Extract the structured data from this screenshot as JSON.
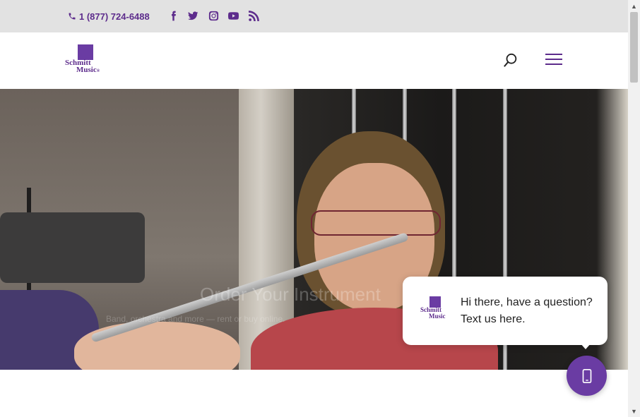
{
  "topbar": {
    "phone": "1 (877) 724-6488",
    "social_icons": [
      "facebook-icon",
      "twitter-icon",
      "instagram-icon",
      "youtube-icon",
      "rss-icon"
    ]
  },
  "header": {
    "logo_line1": "Schmitt",
    "logo_line2": "Music",
    "logo_mark": "®"
  },
  "hero": {
    "title": "Order Your Instrument",
    "subtitle": "Band, orchestra and more — rent or buy online."
  },
  "chat": {
    "message": "Hi there, have a question? Text us here."
  },
  "colors": {
    "brand": "#5d2c8c",
    "accent": "#6a3ca3",
    "topbar_bg": "#e2e2e2"
  }
}
